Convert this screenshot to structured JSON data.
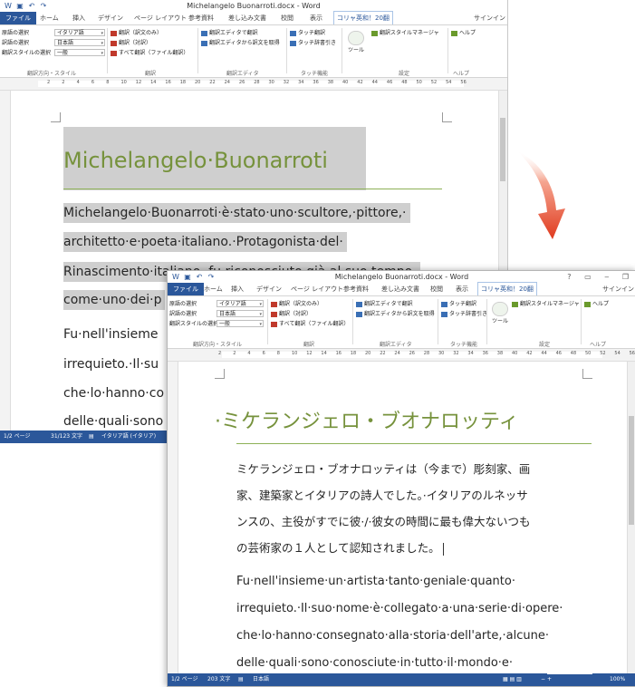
{
  "word": {
    "title": "Michelangelo Buonarroti.docx - Word",
    "tabs": [
      "ファイル",
      "ホーム",
      "挿入",
      "デザイン",
      "ページ レイアウト",
      "参考資料",
      "差し込み文書",
      "校閲",
      "表示",
      "コリャ英和！20翻"
    ],
    "signin": "サインイン",
    "ribbon": {
      "source_lang_label": "原語の選択",
      "target_lang_label": "訳語の選択",
      "style_label": "翻訳スタイルの選択",
      "source_lang_value": "イタリア語",
      "target_lang_value": "日本語",
      "style_value": "一般",
      "btn_translate_only": "翻訳（訳文のみ）",
      "btn_translate_pair": "翻訳（対訳）",
      "btn_translate_all": "すべて翻訳（ファイル翻訳）",
      "btn_editor_translate": "翻訳エディタで翻訳",
      "btn_editor_get": "翻訳エディタから訳文を取得",
      "btn_touch_translate": "タッチ翻訳",
      "btn_touch_dict": "タッチ辞書引き",
      "tool_label": "ツール",
      "btn_style_manager": "翻訳スタイルマネージャ",
      "btn_help": "ヘルプ",
      "groups": [
        "翻訳方向・スタイル",
        "翻訳",
        "翻訳エディタ",
        "タッチ機能",
        "設定",
        "ヘルプ"
      ]
    },
    "ruler_numbers": [
      "2",
      "2",
      "4",
      "6",
      "8",
      "10",
      "12",
      "14",
      "16",
      "18",
      "20",
      "22",
      "24",
      "26",
      "28",
      "30",
      "32",
      "34",
      "36",
      "38",
      "40",
      "42",
      "44",
      "46",
      "48",
      "50",
      "52",
      "54",
      "56"
    ]
  },
  "doc1": {
    "heading": "Michelangelo·Buonarroti",
    "lines": [
      "Michelangelo·Buonarroti·è·stato·uno·scultore,·pittore,·",
      "architetto·e·poeta·italiano.·Protagonista·del·",
      "Rinascimento·italiano,·fu·riconosciuto·già·al·suo·tempo·",
      "come·uno·dei·p",
      "Fu·nell'insieme",
      "irrequieto.·Il·su",
      "che·lo·hanno·co",
      "delle·quali·sono"
    ],
    "status": {
      "page": "1/2 ページ",
      "words": "31/123 文字",
      "lang": "イタリア語 (イタリア)"
    }
  },
  "doc2": {
    "heading": "·ミケランジェロ・ブオナロッティ",
    "lines_jp": [
      "ミケランジェロ・ブオナロッティは（今まで）彫刻家、画",
      "家、建築家とイタリアの詩人でした。·イタリアのルネッサ",
      "ンスの、主役がすでに彼·/·彼女の時間に最も偉大ないつも",
      "の芸術家の１人として認知されました。"
    ],
    "lines_it": [
      "Fu·nell'insieme·un·artista·tanto·geniale·quanto·",
      "irrequieto.·Il·suo·nome·è·collegato·a·una·serie·di·opere·",
      "che·lo·hanno·consegnato·alla·storia·dell'arte,·alcune·",
      "delle·quali·sono·conosciute·in·tutto·il·mondo·e·"
    ],
    "status": {
      "page": "1/2 ページ",
      "words": "203 文字",
      "lang": "日本語",
      "zoom": "100%"
    }
  },
  "colors": {
    "accent": "#2b579a",
    "heading": "#76923c",
    "arrow": "#e03a1e"
  }
}
